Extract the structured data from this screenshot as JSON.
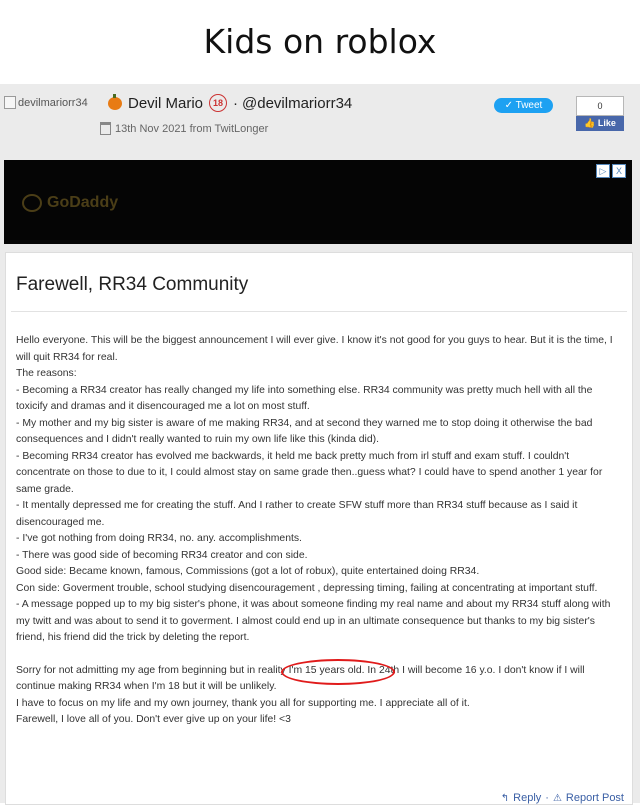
{
  "meme_title": "Kids on roblox",
  "header": {
    "avatar_alt": "devilmariorr34",
    "display_name": "Devil Mario",
    "age_badge": "18",
    "handle_sep": "·",
    "handle": "@devilmariorr34",
    "date_line": "13th Nov 2021 from TwitLonger",
    "tweet_label": "Tweet",
    "share_count": "0",
    "like_label": "Like"
  },
  "ad": {
    "brand": "GoDaddy",
    "play_icon": "▷",
    "close_icon": "X"
  },
  "post": {
    "title": "Farewell, RR34 Community",
    "lines": [
      "Hello everyone. This will be the biggest announcement I will ever give. I know it's not good for you guys to hear. But it is the time, I will quit RR34 for real.",
      "The reasons:",
      "- Becoming a RR34 creator has really changed my life into something else. RR34 community was pretty much hell with all the toxicify and dramas and it disencouraged me a lot on most stuff.",
      "- My mother and my big sister is aware of me making RR34, and at second they warned me to stop doing it otherwise the bad consequences and I didn't really wanted to ruin my own life like this (kinda did).",
      "- Becoming RR34 creator has evolved me backwards, it held me back pretty much from irl stuff and exam stuff. I couldn't concentrate on those to due to it, I could almost stay on same grade then..guess what? I could have to spend another 1 year for same grade.",
      "- It mentally depressed me for creating the stuff. And I rather to create SFW stuff more than RR34 stuff because as I said it disencouraged me.",
      "- I've got nothing from doing RR34, no. any. accomplishments.",
      "- There was good side of becoming RR34 creator and con side.",
      "Good side: Became known, famous, Commissions (got a lot of robux), quite entertained doing RR34.",
      "Con side: Goverment trouble, school studying disencouragement , depressing timing, failing at concentrating at important stuff.",
      "- A message popped up to my big sister's phone, it was about someone finding my real name and about my RR34 stuff along with my twitt and was about to send it to goverment. I almost could end up in an ultimate consequence but thanks to my big sister's friend, his friend did the trick by deleting the report."
    ],
    "closing_before": "Sorry for not admitting my age from beginning but in reality ",
    "closing_circled": "I'm 15 years old.",
    "closing_after": " In 24th I will become 16 y.o. I don't know if I will continue making RR34 when I'm 18 but it will be unlikely.",
    "closing_lines": [
      "I have to focus on my life and my own journey, thank you all for supporting me. I appreciate all of it.",
      "Farewell, I love all of you. Don't ever give up on your life! <3"
    ],
    "reply_label": "Reply",
    "footer_sep": "·",
    "report_label": "Report Post"
  }
}
